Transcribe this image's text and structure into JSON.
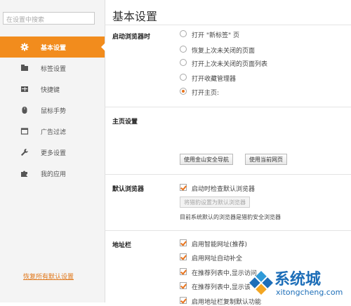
{
  "sidebar": {
    "search_placeholder": "在设置中搜索",
    "items": [
      {
        "label": "基本设置",
        "icon": "gear-icon",
        "active": true
      },
      {
        "label": "标签设置",
        "icon": "tab-icon"
      },
      {
        "label": "快捷键",
        "icon": "keyboard-icon"
      },
      {
        "label": "鼠标手势",
        "icon": "mouse-icon"
      },
      {
        "label": "广告过滤",
        "icon": "ad-filter-icon"
      },
      {
        "label": "更多设置",
        "icon": "wrench-icon"
      },
      {
        "label": "我的应用",
        "icon": "puzzle-icon"
      }
    ],
    "restore_label": "恢复所有默认设置"
  },
  "main": {
    "title": "基本设置",
    "startup": {
      "label": "启动浏览器时",
      "options": [
        "打开 \"新标签\" 页",
        "恢复上次未关闭的页面",
        "打开上次未关闭的页面列表",
        "打开收藏管理器",
        "打开主页:"
      ],
      "selected_index": 4
    },
    "homepage": {
      "label": "主页设置",
      "btn_kingsoft": "使用金山安全导航",
      "btn_current": "使用当前网页"
    },
    "default_browser": {
      "label": "默认浏览器",
      "check_label": "启动时检查默认浏览器",
      "set_button": "将猎豹设置为默认浏览器",
      "note": "目前系统默认的浏览器是猎豹安全浏览器"
    },
    "address_bar": {
      "label": "地址栏",
      "options": [
        "启用智能网址(推荐)",
        "启用网址自动补全",
        "在推荐列表中,显示访问",
        "在推荐列表中,显示该",
        "启用地址栏复制默认功能"
      ]
    }
  },
  "watermark": {
    "text": "系统城",
    "url": "xitongcheng.com"
  },
  "colors": {
    "accent": "#f28c1d",
    "watermark_blue": "#1d6eb8"
  }
}
